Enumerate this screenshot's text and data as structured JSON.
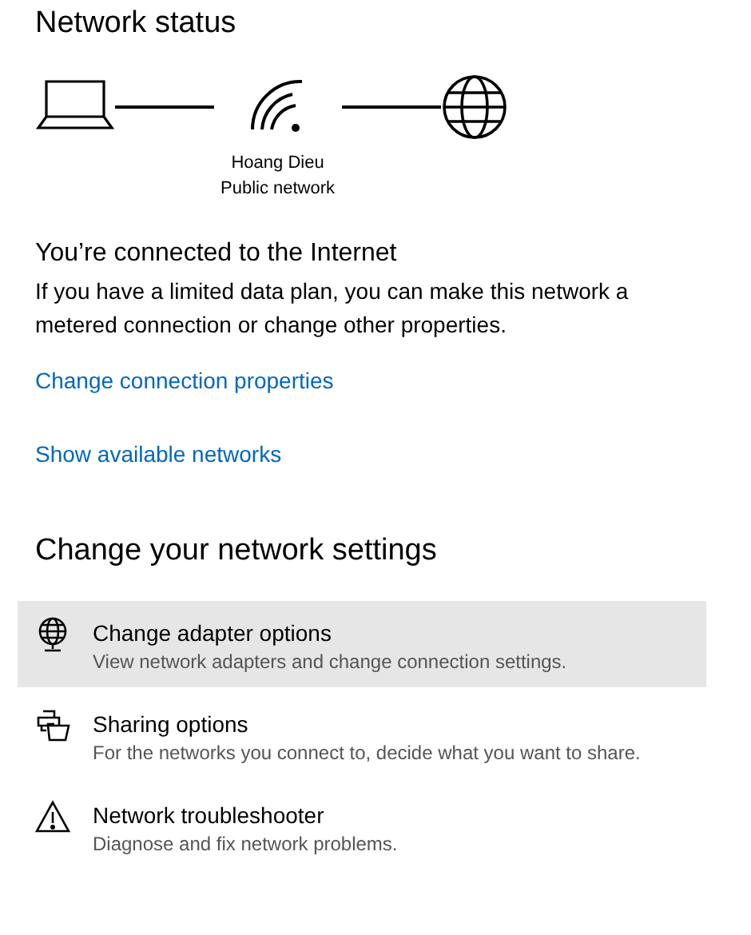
{
  "status_heading": "Network status",
  "network": {
    "name": "Hoang Dieu",
    "type": "Public network"
  },
  "connection": {
    "title": "You’re connected to the Internet",
    "description": "If you have a limited data plan, you can make this network a metered connection or change other properties."
  },
  "links": [
    "Change connection properties",
    "Show available networks"
  ],
  "settings_heading": "Change your network settings",
  "settings": [
    {
      "kind": "adapter",
      "title": "Change adapter options",
      "description": "View network adapters and change connection settings.",
      "selected": true
    },
    {
      "kind": "sharing",
      "title": "Sharing options",
      "description": "For the networks you connect to, decide what you want to share.",
      "selected": false
    },
    {
      "kind": "troubleshoot",
      "title": "Network troubleshooter",
      "description": "Diagnose and fix network problems.",
      "selected": false
    }
  ]
}
